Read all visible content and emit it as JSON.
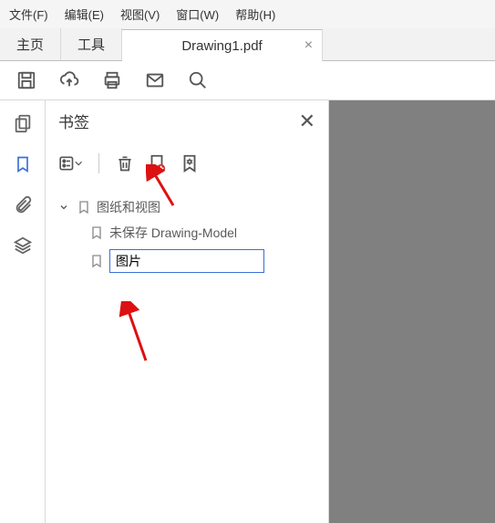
{
  "menus": {
    "file": "文件(F)",
    "edit": "编辑(E)",
    "view": "视图(V)",
    "window": "窗口(W)",
    "help": "帮助(H)"
  },
  "tabs": {
    "home": "主页",
    "tools": "工具",
    "doc": "Drawing1.pdf"
  },
  "panel": {
    "title": "书签"
  },
  "tree": {
    "root": "图纸和视图",
    "unsaved": "未保存 Drawing-Model",
    "editing": "图片"
  }
}
